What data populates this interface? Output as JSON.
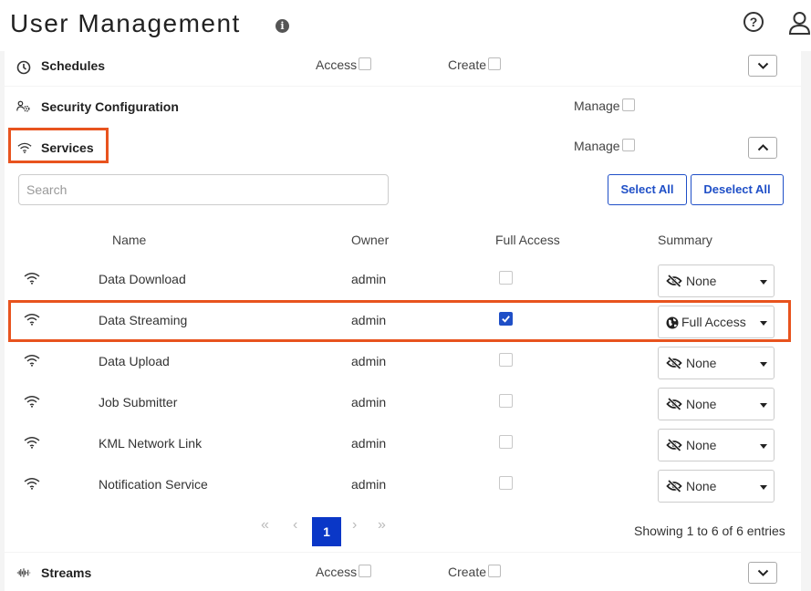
{
  "header": {
    "title": "User Management",
    "info_glyph": "i",
    "help_glyph": "?"
  },
  "sections": {
    "schedules": {
      "title": "Schedules",
      "access_label": "Access",
      "create_label": "Create"
    },
    "security": {
      "title": "Security Configuration",
      "manage_label": "Manage"
    },
    "services": {
      "title": "Services",
      "manage_label": "Manage"
    },
    "streams": {
      "title": "Streams",
      "access_label": "Access",
      "create_label": "Create"
    }
  },
  "services": {
    "search_placeholder": "Search",
    "select_all": "Select All",
    "deselect_all": "Deselect All",
    "columns": {
      "name": "Name",
      "owner": "Owner",
      "full_access": "Full Access",
      "summary": "Summary"
    },
    "rows": [
      {
        "name": "Data Download",
        "owner": "admin",
        "full_access": false,
        "summary": "None"
      },
      {
        "name": "Data Streaming",
        "owner": "admin",
        "full_access": true,
        "summary": "Full Access"
      },
      {
        "name": "Data Upload",
        "owner": "admin",
        "full_access": false,
        "summary": "None"
      },
      {
        "name": "Job Submitter",
        "owner": "admin",
        "full_access": false,
        "summary": "None"
      },
      {
        "name": "KML Network Link",
        "owner": "admin",
        "full_access": false,
        "summary": "None"
      },
      {
        "name": "Notification Service",
        "owner": "admin",
        "full_access": false,
        "summary": "None"
      }
    ],
    "pagination": {
      "first": "«",
      "prev": "‹",
      "current": "1",
      "next": "›",
      "last": "»",
      "showing": "Showing 1 to 6 of 6 entries"
    }
  },
  "colors": {
    "accent": "#1f4fc7",
    "highlight": "#e8531e",
    "page_active": "#0a37c7"
  },
  "icons": {
    "schedules": "clock-icon",
    "security": "users-gear-icon",
    "services": "wifi-icon",
    "streams": "waveform-icon",
    "summary_none": "eye-slash-icon",
    "summary_full": "globe-icon"
  }
}
